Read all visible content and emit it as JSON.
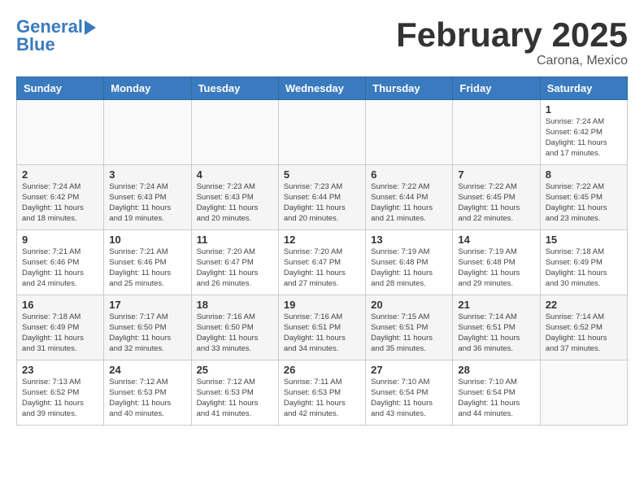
{
  "header": {
    "logo_line1": "General",
    "logo_line2": "Blue",
    "month_title": "February 2025",
    "location": "Carona, Mexico"
  },
  "weekdays": [
    "Sunday",
    "Monday",
    "Tuesday",
    "Wednesday",
    "Thursday",
    "Friday",
    "Saturday"
  ],
  "weeks": [
    [
      {
        "day": "",
        "info": ""
      },
      {
        "day": "",
        "info": ""
      },
      {
        "day": "",
        "info": ""
      },
      {
        "day": "",
        "info": ""
      },
      {
        "day": "",
        "info": ""
      },
      {
        "day": "",
        "info": ""
      },
      {
        "day": "1",
        "info": "Sunrise: 7:24 AM\nSunset: 6:42 PM\nDaylight: 11 hours\nand 17 minutes."
      }
    ],
    [
      {
        "day": "2",
        "info": "Sunrise: 7:24 AM\nSunset: 6:42 PM\nDaylight: 11 hours\nand 18 minutes."
      },
      {
        "day": "3",
        "info": "Sunrise: 7:24 AM\nSunset: 6:43 PM\nDaylight: 11 hours\nand 19 minutes."
      },
      {
        "day": "4",
        "info": "Sunrise: 7:23 AM\nSunset: 6:43 PM\nDaylight: 11 hours\nand 20 minutes."
      },
      {
        "day": "5",
        "info": "Sunrise: 7:23 AM\nSunset: 6:44 PM\nDaylight: 11 hours\nand 20 minutes."
      },
      {
        "day": "6",
        "info": "Sunrise: 7:22 AM\nSunset: 6:44 PM\nDaylight: 11 hours\nand 21 minutes."
      },
      {
        "day": "7",
        "info": "Sunrise: 7:22 AM\nSunset: 6:45 PM\nDaylight: 11 hours\nand 22 minutes."
      },
      {
        "day": "8",
        "info": "Sunrise: 7:22 AM\nSunset: 6:45 PM\nDaylight: 11 hours\nand 23 minutes."
      }
    ],
    [
      {
        "day": "9",
        "info": "Sunrise: 7:21 AM\nSunset: 6:46 PM\nDaylight: 11 hours\nand 24 minutes."
      },
      {
        "day": "10",
        "info": "Sunrise: 7:21 AM\nSunset: 6:46 PM\nDaylight: 11 hours\nand 25 minutes."
      },
      {
        "day": "11",
        "info": "Sunrise: 7:20 AM\nSunset: 6:47 PM\nDaylight: 11 hours\nand 26 minutes."
      },
      {
        "day": "12",
        "info": "Sunrise: 7:20 AM\nSunset: 6:47 PM\nDaylight: 11 hours\nand 27 minutes."
      },
      {
        "day": "13",
        "info": "Sunrise: 7:19 AM\nSunset: 6:48 PM\nDaylight: 11 hours\nand 28 minutes."
      },
      {
        "day": "14",
        "info": "Sunrise: 7:19 AM\nSunset: 6:48 PM\nDaylight: 11 hours\nand 29 minutes."
      },
      {
        "day": "15",
        "info": "Sunrise: 7:18 AM\nSunset: 6:49 PM\nDaylight: 11 hours\nand 30 minutes."
      }
    ],
    [
      {
        "day": "16",
        "info": "Sunrise: 7:18 AM\nSunset: 6:49 PM\nDaylight: 11 hours\nand 31 minutes."
      },
      {
        "day": "17",
        "info": "Sunrise: 7:17 AM\nSunset: 6:50 PM\nDaylight: 11 hours\nand 32 minutes."
      },
      {
        "day": "18",
        "info": "Sunrise: 7:16 AM\nSunset: 6:50 PM\nDaylight: 11 hours\nand 33 minutes."
      },
      {
        "day": "19",
        "info": "Sunrise: 7:16 AM\nSunset: 6:51 PM\nDaylight: 11 hours\nand 34 minutes."
      },
      {
        "day": "20",
        "info": "Sunrise: 7:15 AM\nSunset: 6:51 PM\nDaylight: 11 hours\nand 35 minutes."
      },
      {
        "day": "21",
        "info": "Sunrise: 7:14 AM\nSunset: 6:51 PM\nDaylight: 11 hours\nand 36 minutes."
      },
      {
        "day": "22",
        "info": "Sunrise: 7:14 AM\nSunset: 6:52 PM\nDaylight: 11 hours\nand 37 minutes."
      }
    ],
    [
      {
        "day": "23",
        "info": "Sunrise: 7:13 AM\nSunset: 6:52 PM\nDaylight: 11 hours\nand 39 minutes."
      },
      {
        "day": "24",
        "info": "Sunrise: 7:12 AM\nSunset: 6:53 PM\nDaylight: 11 hours\nand 40 minutes."
      },
      {
        "day": "25",
        "info": "Sunrise: 7:12 AM\nSunset: 6:53 PM\nDaylight: 11 hours\nand 41 minutes."
      },
      {
        "day": "26",
        "info": "Sunrise: 7:11 AM\nSunset: 6:53 PM\nDaylight: 11 hours\nand 42 minutes."
      },
      {
        "day": "27",
        "info": "Sunrise: 7:10 AM\nSunset: 6:54 PM\nDaylight: 11 hours\nand 43 minutes."
      },
      {
        "day": "28",
        "info": "Sunrise: 7:10 AM\nSunset: 6:54 PM\nDaylight: 11 hours\nand 44 minutes."
      },
      {
        "day": "",
        "info": ""
      }
    ]
  ]
}
